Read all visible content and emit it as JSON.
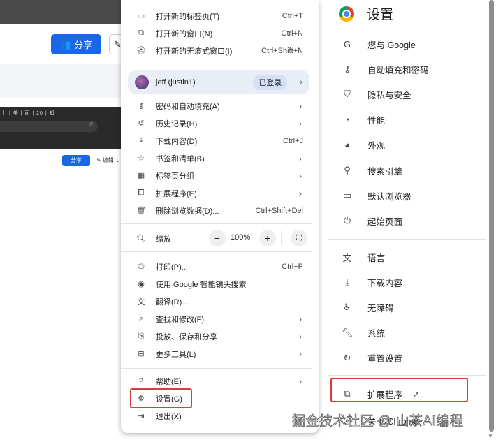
{
  "background": {
    "share_label": "分享",
    "edit_label": "编辑",
    "tabs_text": "上 | 美 | 面 | 20 | 知"
  },
  "menu": {
    "items_top": [
      {
        "icon": "new-tab-icon",
        "label": "打开新的标签页(T)",
        "shortcut": "Ctrl+T"
      },
      {
        "icon": "new-window-icon",
        "label": "打开新的窗口(N)",
        "shortcut": "Ctrl+N"
      },
      {
        "icon": "incognito-icon",
        "label": "打开新的无痕式窗口(I)",
        "shortcut": "Ctrl+Shift+N"
      }
    ],
    "profile": {
      "name": "jeff (justin1)",
      "status": "已登录"
    },
    "items_mid": [
      {
        "icon": "key-icon",
        "label": "密码和自动填充(A)",
        "shortcut": "",
        "submenu": true
      },
      {
        "icon": "history-icon",
        "label": "历史记录(H)",
        "shortcut": "",
        "submenu": true
      },
      {
        "icon": "download-icon",
        "label": "下载内容(D)",
        "shortcut": "Ctrl+J",
        "submenu": false
      },
      {
        "icon": "star-icon",
        "label": "书签和清单(B)",
        "shortcut": "",
        "submenu": true
      },
      {
        "icon": "tab-groups-icon",
        "label": "标签页分组",
        "shortcut": "",
        "submenu": true
      },
      {
        "icon": "extension-icon",
        "label": "扩展程序(E)",
        "shortcut": "",
        "submenu": true
      },
      {
        "icon": "trash-icon",
        "label": "删除浏览数据(D)...",
        "shortcut": "Ctrl+Shift+Del",
        "submenu": false
      }
    ],
    "zoom": {
      "label": "缩放",
      "value": "100%",
      "minus": "−",
      "plus": "+"
    },
    "items_tools": [
      {
        "icon": "print-icon",
        "label": "打印(P)...",
        "shortcut": "Ctrl+P",
        "submenu": false
      },
      {
        "icon": "google-lens-icon",
        "label": "使用 Google 智能镜头搜索",
        "shortcut": "",
        "submenu": false
      },
      {
        "icon": "translate-icon",
        "label": "翻译(R)...",
        "shortcut": "",
        "submenu": false
      },
      {
        "icon": "find-icon",
        "label": "查找和修改(F)",
        "shortcut": "",
        "submenu": true
      },
      {
        "icon": "cast-icon",
        "label": "投放、保存和分享",
        "shortcut": "",
        "submenu": true
      },
      {
        "icon": "toolbox-icon",
        "label": "更多工具(L)",
        "shortcut": "",
        "submenu": true
      }
    ],
    "items_bottom": [
      {
        "icon": "help-icon",
        "label": "帮助(E)",
        "submenu": true
      },
      {
        "icon": "gear-icon",
        "label": "设置(G)",
        "submenu": false
      },
      {
        "icon": "exit-icon",
        "label": "退出(X)",
        "submenu": false
      }
    ]
  },
  "settings": {
    "title": "设置",
    "group1": [
      {
        "icon": "google-icon",
        "label": "您与 Google"
      },
      {
        "icon": "key-icon",
        "label": "自动填充和密码"
      },
      {
        "icon": "shield-icon",
        "label": "隐私与安全"
      },
      {
        "icon": "gauge-icon",
        "label": "性能"
      },
      {
        "icon": "palette-icon",
        "label": "外观"
      },
      {
        "icon": "search-icon",
        "label": "搜索引擎"
      },
      {
        "icon": "browser-icon",
        "label": "默认浏览器"
      },
      {
        "icon": "power-icon",
        "label": "起始页面"
      }
    ],
    "group2": [
      {
        "icon": "language-icon",
        "label": "语言"
      },
      {
        "icon": "download-icon",
        "label": "下载内容"
      },
      {
        "icon": "accessibility-icon",
        "label": "无障碍"
      },
      {
        "icon": "wrench-icon",
        "label": "系统"
      },
      {
        "icon": "reset-icon",
        "label": "重置设置"
      }
    ],
    "extensions": {
      "label": "扩展程序"
    },
    "about": {
      "label": "关于 Chrome"
    }
  },
  "watermark": "掘金技术社区 @ 山茶AI编程"
}
